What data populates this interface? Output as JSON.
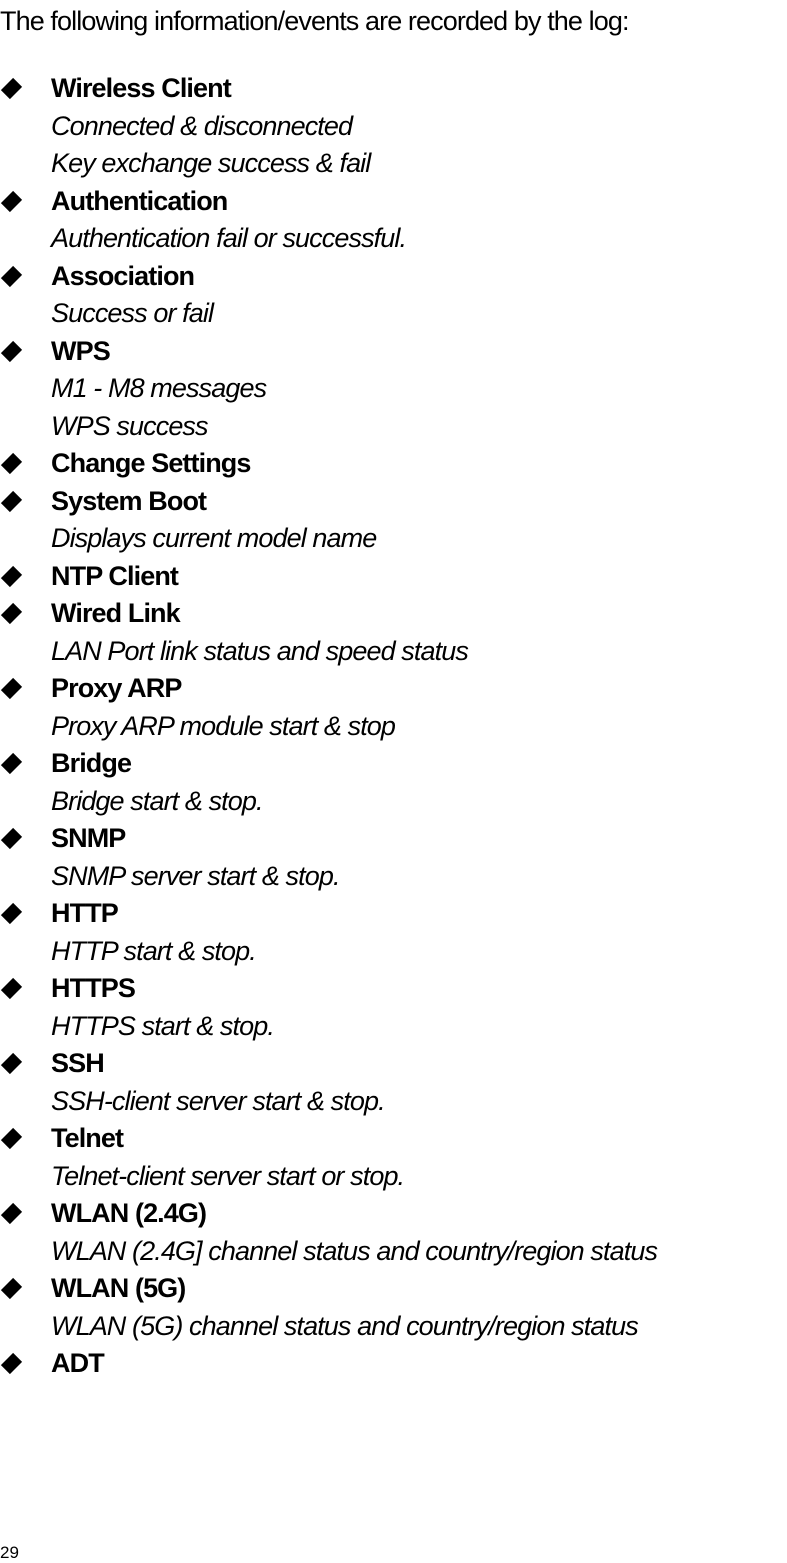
{
  "intro": "The following information/events are recorded by the log:",
  "items": [
    {
      "title": "Wireless Client",
      "details": [
        "Connected & disconnected",
        "Key exchange success & fail"
      ]
    },
    {
      "title": "Authentication",
      "details": [
        "Authentication fail or successful."
      ]
    },
    {
      "title": "Association",
      "details": [
        "Success or fail"
      ]
    },
    {
      "title": "WPS",
      "details": [
        "M1 - M8 messages",
        "WPS success"
      ]
    },
    {
      "title": "Change Settings",
      "details": []
    },
    {
      "title": "System Boot",
      "details": [
        "Displays current model name"
      ]
    },
    {
      "title": "NTP Client",
      "details": []
    },
    {
      "title": "Wired Link",
      "details": [
        "LAN Port link status and speed status"
      ]
    },
    {
      "title": "Proxy ARP",
      "details": [
        "Proxy ARP module start & stop"
      ]
    },
    {
      "title": "Bridge",
      "details": [
        "Bridge start & stop."
      ]
    },
    {
      "title": "SNMP",
      "details": [
        "SNMP server start & stop."
      ]
    },
    {
      "title": "HTTP",
      "details": [
        "HTTP start & stop."
      ]
    },
    {
      "title": "HTTPS",
      "details": [
        "HTTPS start & stop."
      ]
    },
    {
      "title": "SSH",
      "details": [
        "SSH-client server start & stop."
      ]
    },
    {
      "title": "Telnet",
      "details": [
        "Telnet-client server start or stop."
      ]
    },
    {
      "title": "WLAN (2.4G)",
      "details": [
        "WLAN (2.4G] channel status and country/region status"
      ]
    },
    {
      "title": "WLAN (5G)",
      "details": [
        "WLAN (5G) channel status and country/region status"
      ]
    },
    {
      "title": "ADT",
      "details": []
    }
  ],
  "page_number": "29"
}
